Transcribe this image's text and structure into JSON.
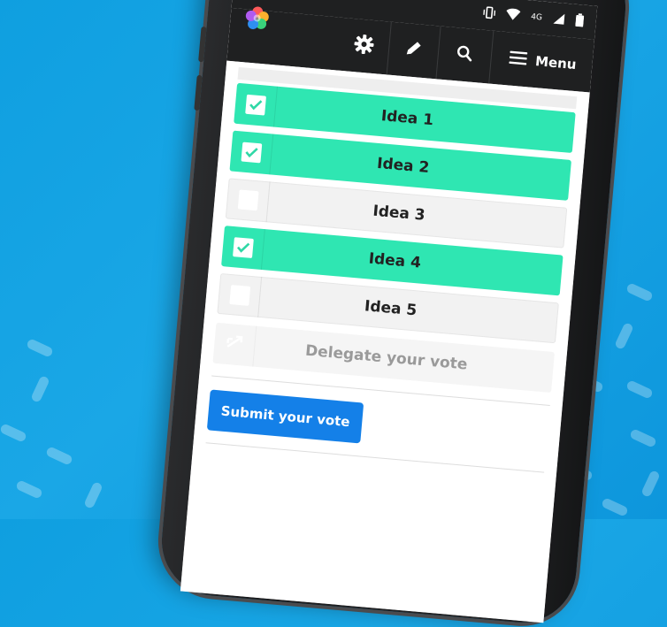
{
  "colors": {
    "background": "#0f9fe0",
    "checked_option": "#2fe6b2",
    "unchecked_option": "#f2f2f2",
    "submit_button": "#1480e8",
    "app_bar": "#1f2021"
  },
  "status_bar": {
    "network": "4G",
    "icons": [
      "vibrate-icon",
      "wifi-icon",
      "signal-icon",
      "battery-icon"
    ]
  },
  "app_bar": {
    "icons": [
      "settings-gear-icon",
      "pencil-icon",
      "search-icon",
      "hamburger-menu-icon"
    ],
    "menu_label": "Menu"
  },
  "options": [
    {
      "label": "Idea 1",
      "checked": true
    },
    {
      "label": "Idea 2",
      "checked": true
    },
    {
      "label": "Idea 3",
      "checked": false
    },
    {
      "label": "Idea 4",
      "checked": true
    },
    {
      "label": "Idea 5",
      "checked": false
    }
  ],
  "delegate": {
    "label": "Delegate your vote",
    "enabled": false
  },
  "submit_label": "Submit your vote"
}
